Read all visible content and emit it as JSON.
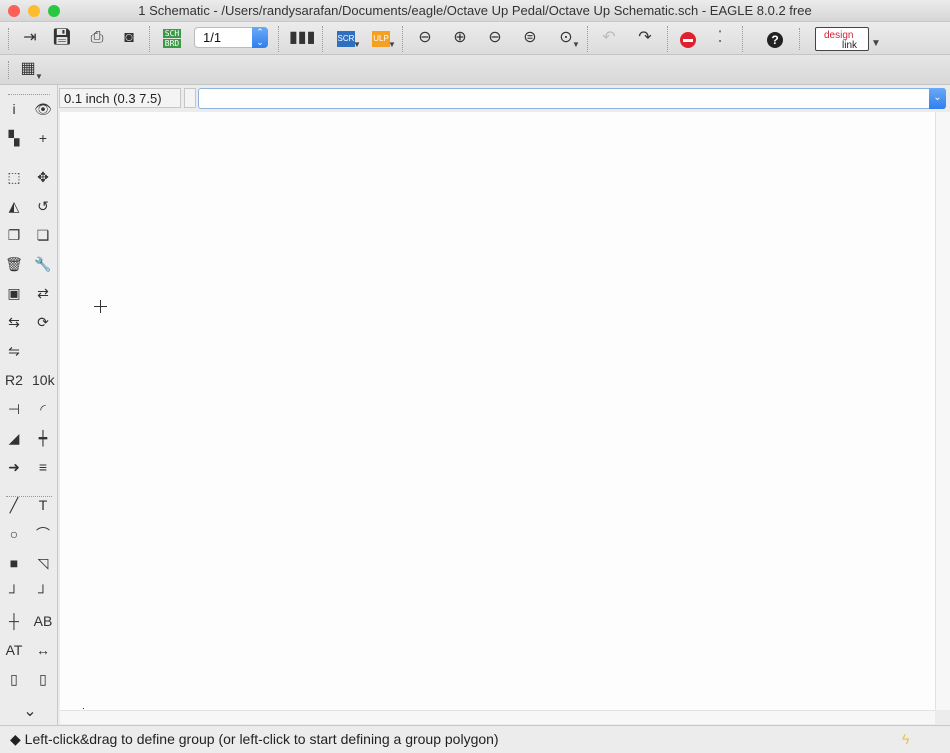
{
  "window": {
    "title": "1 Schematic - /Users/randysarafan/Documents/eagle/Octave Up Pedal/Octave Up Schematic.sch - EAGLE 8.0.2 free"
  },
  "toolbar": {
    "sch_brd_top": "SCH",
    "sch_brd_bottom": "BRD",
    "page_value": "1/1",
    "scr_label": "SCR",
    "ulp_label": "ULP",
    "help_label": "?",
    "designlink_top": "design",
    "designlink_bottom": "link"
  },
  "command": {
    "grid_info": "0.1 inch (0.3 7.5)",
    "input_value": ""
  },
  "status": {
    "message": "Left-click&drag to define group (or left-click to start defining a group polygon)",
    "icon": "diamond-icon"
  },
  "colors": {
    "accent": "#2f7ff0",
    "stop": "#e0202f",
    "brd_green": "#3a9a45",
    "scr_blue": "#2f6fc0",
    "ulp_orange": "#f5a020"
  },
  "sidebar": {
    "tools": [
      [
        "info",
        "i"
      ],
      [
        "show",
        "👁"
      ],
      [
        "layers",
        "▚"
      ],
      [
        "mark",
        "+"
      ],
      [
        "group",
        "⬚"
      ],
      [
        "move",
        "✥"
      ],
      [
        "mirror",
        "◭"
      ],
      [
        "rotate",
        "↺"
      ],
      [
        "copy",
        "❐"
      ],
      [
        "paste",
        "❏"
      ],
      [
        "delete",
        "🗑"
      ],
      [
        "change",
        "🔧"
      ],
      [
        "add",
        "▣"
      ],
      [
        "replace",
        "⇄"
      ],
      [
        "swap",
        "⇆"
      ],
      [
        "rotate-gate",
        "⟳"
      ],
      [
        "invoke",
        "⇋"
      ],
      [
        "",
        ""
      ],
      [
        "name",
        "R2"
      ],
      [
        "value",
        "10k"
      ],
      [
        "pinswap",
        "⊣"
      ],
      [
        "miter",
        "◜"
      ],
      [
        "split",
        "◢"
      ],
      [
        "optimize",
        "┿"
      ],
      [
        "gateswap",
        "➜"
      ],
      [
        "smash",
        "≡"
      ],
      [
        "line",
        "╱"
      ],
      [
        "text",
        "T"
      ],
      [
        "circle",
        "○"
      ],
      [
        "arc",
        "⌒"
      ],
      [
        "rect",
        "■"
      ],
      [
        "polygon",
        "◹"
      ],
      [
        "bus",
        "┘"
      ],
      [
        "net",
        "┘"
      ],
      [
        "junction",
        "┼"
      ],
      [
        "label",
        "AB"
      ],
      [
        "attribute",
        "AT"
      ],
      [
        "dimension",
        "↔"
      ],
      [
        "frame",
        "▯"
      ],
      [
        "module",
        "▯"
      ]
    ]
  }
}
